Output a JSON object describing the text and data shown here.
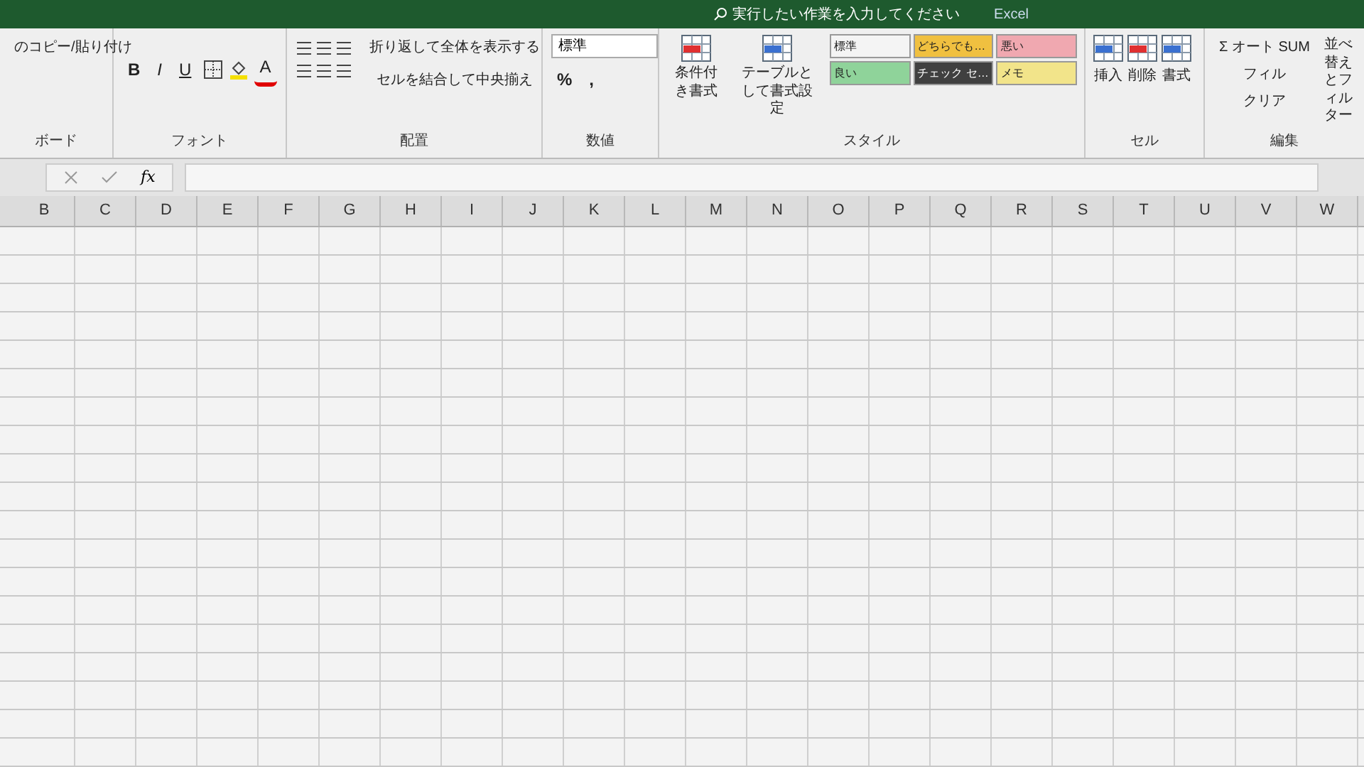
{
  "title_bar": {
    "search_hint": "実行したい作業を入力してください",
    "app_name": "Excel"
  },
  "ribbon": {
    "clipboard": {
      "item": "のコピー/貼り付け",
      "group_label": "ボード"
    },
    "font": {
      "bold": "B",
      "italic": "I",
      "underline": "U",
      "font_color": "A",
      "group_label": "フォント"
    },
    "alignment": {
      "wrap_text": "折り返して全体を表示する",
      "merge_center": "セルを結合して中央揃え",
      "group_label": "配置"
    },
    "number": {
      "format": "標準",
      "percent": "%",
      "comma": ",",
      "group_label": "数値"
    },
    "styles": {
      "conditional": "条件付き書式",
      "format_table": "テーブルとして書式設定",
      "group_label": "スタイル",
      "cells": [
        {
          "label": "標準",
          "color": "#f4f4f4"
        },
        {
          "label": "どちらでも…",
          "color": "#f0c040"
        },
        {
          "label": "悪い",
          "color": "#f0a8b0"
        },
        {
          "label": "良い",
          "color": "#8fd39a"
        },
        {
          "label": "チェック セ…",
          "color": "#404040"
        },
        {
          "label": "メモ",
          "color": "#f2e48a"
        }
      ]
    },
    "cells": {
      "insert": "挿入",
      "delete": "削除",
      "format": "書式",
      "group_label": "セル"
    },
    "editing": {
      "autosum": "Σ オート SUM",
      "fill": "フィル",
      "clear": "クリア",
      "sort_filter": "並べ替えとフィルター",
      "group_label": "編集"
    }
  },
  "formula_bar": {
    "fx": "fx"
  },
  "sheet": {
    "columns": [
      "B",
      "C",
      "D",
      "E",
      "F",
      "G",
      "H",
      "I",
      "J",
      "K",
      "L",
      "M",
      "N",
      "O",
      "P",
      "Q",
      "R",
      "S",
      "T",
      "U",
      "V",
      "W"
    ]
  }
}
